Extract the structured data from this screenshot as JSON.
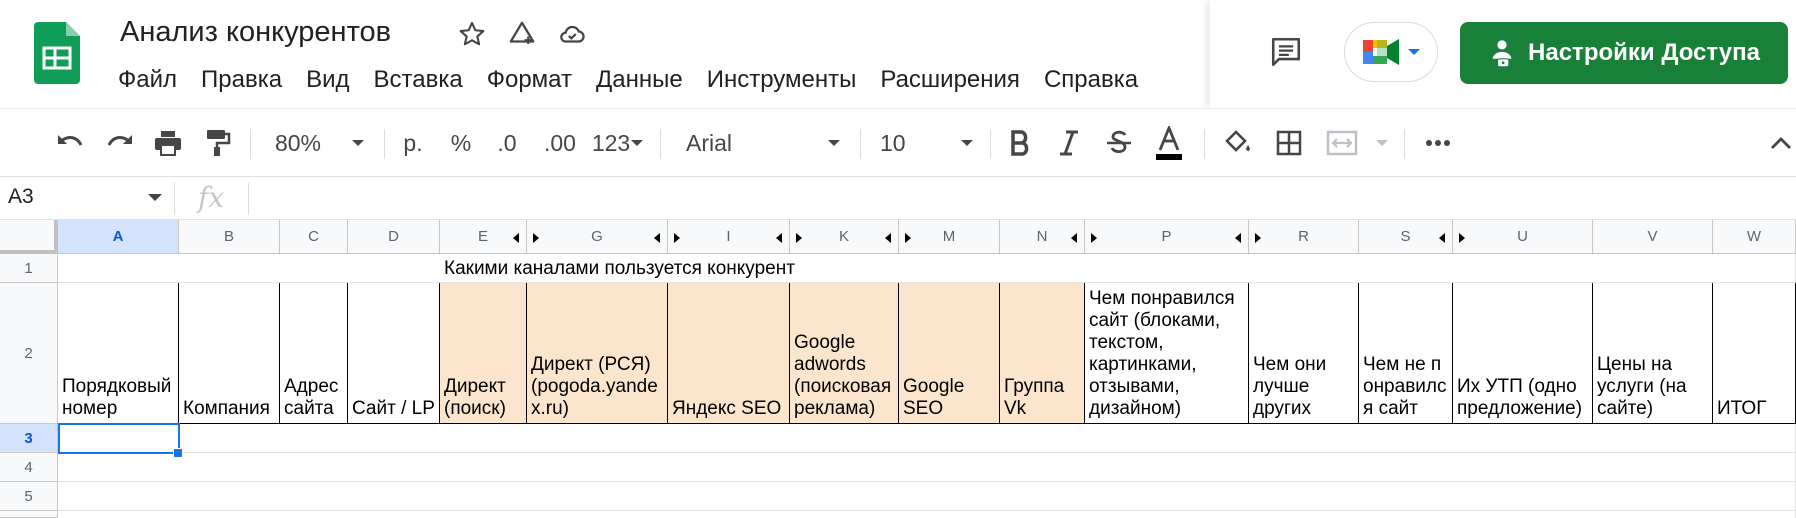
{
  "header": {
    "title": "Анализ конкурентов",
    "menu": [
      "Файл",
      "Правка",
      "Вид",
      "Вставка",
      "Формат",
      "Данные",
      "Инструменты",
      "Расширения",
      "Справка"
    ],
    "share_label": "Настройки Доступа",
    "brand_color": "#188038"
  },
  "toolbar": {
    "zoom": "80%",
    "currency": "р.",
    "percent": "%",
    "dec_decrease": ".0",
    "dec_increase": ".00",
    "format_more": "123",
    "font": "Arial",
    "font_size": "10"
  },
  "formula_bar": {
    "cell_ref": "A3",
    "fx": "fx",
    "value": ""
  },
  "sheet": {
    "columns": [
      "A",
      "B",
      "C",
      "D",
      "E",
      "G",
      "I",
      "K",
      "M",
      "N",
      "P",
      "R",
      "S",
      "U",
      "V",
      "W"
    ],
    "rows": [
      "1",
      "2",
      "3",
      "4",
      "5"
    ],
    "group_title": "Какими каналами пользуется конкурент",
    "headers": [
      "Порядковый номер",
      "Компания",
      "Адрес сайта",
      "Сайт / LP",
      "Директ (поиск)",
      "Директ (РСЯ) (pogoda.yandex.ru)",
      "Яндекс SEO",
      "Google adwords (поисковая реклама)",
      "Google SEO",
      "Группа Vk",
      "Чем понравился сайт (блоками, текстом, картинками, отзывами, дизайном)",
      "Чем они лучше других",
      "Чем не понравился сайт",
      "Их УТП (одно предложение)",
      "Цены на услуги (на сайте)",
      "ИТОГ"
    ],
    "highlight_color": "#fce5cd",
    "selected_cell": "A3"
  }
}
